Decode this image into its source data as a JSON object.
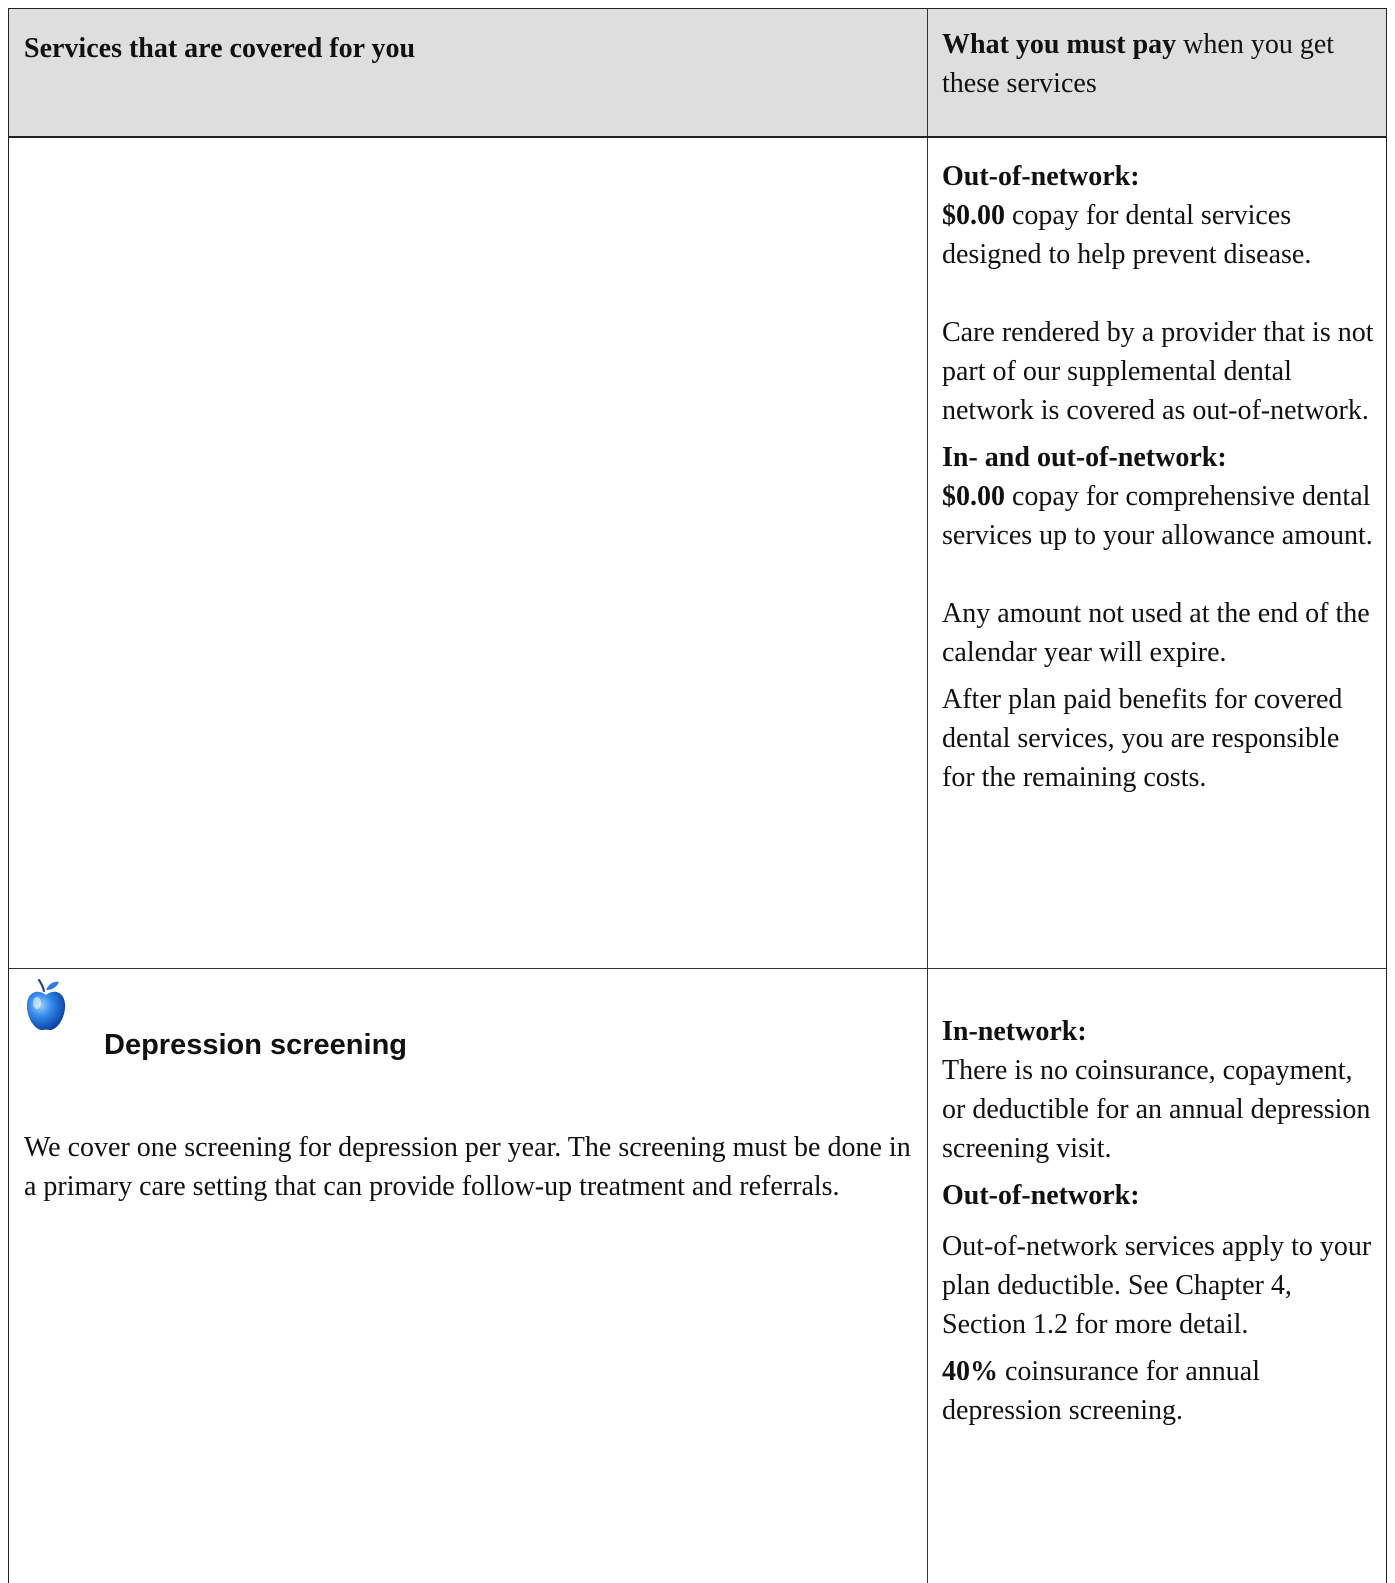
{
  "header": {
    "left_label": "Services that are covered for you",
    "right_label_bold": "What you must pay",
    "right_label_rest": " when you get these services"
  },
  "dental_row": {
    "out_of_network_label": "Out-of-network:",
    "copay_amount": "$0.00",
    "copay_text": " copay for dental services designed to help prevent disease.",
    "provider_note": "Care rendered by a provider that is not part of our supplemental dental network is covered as out-of-network.",
    "in_out_label": "In- and out-of-network:",
    "comprehensive_amount": "$0.00",
    "comprehensive_text": " copay for comprehensive dental services up to your allowance amount.",
    "expire_note": "Any amount not used at the end of the calendar year will expire.",
    "remaining_note": "After plan paid benefits for covered dental services, you are responsible for the remaining costs."
  },
  "depression_row": {
    "icon": "apple-icon",
    "title": "Depression screening",
    "description": "We cover one screening for depression per year. The screening must be done in a primary care setting that can provide follow-up treatment and referrals.",
    "in_network_label": "In-network:",
    "in_network_text": "There is no coinsurance, copayment, or deductible for an annual depression screening visit.",
    "out_of_network_label": "Out-of-network:",
    "out_of_network_text": "Out-of-network services apply to your plan deductible. See Chapter 4, Section 1.2 for more detail.",
    "coinsurance_amount": "40%",
    "coinsurance_text": " coinsurance for annual depression screening."
  },
  "colors": {
    "header_background": "#dedede",
    "apple_blue": "#1e6fd9"
  }
}
